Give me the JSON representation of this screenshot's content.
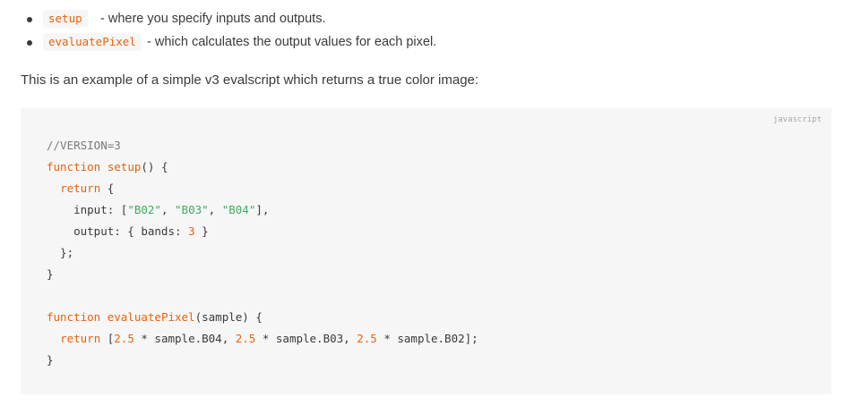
{
  "bullets": [
    {
      "code": "setup",
      "text": "- where you specify inputs and outputs."
    },
    {
      "code": "evaluatePixel",
      "text": "- which calculates the output values for each pixel."
    }
  ],
  "intro": "This is an example of a simple v3 evalscript which returns a true color image:",
  "code_block": {
    "language": "javascript",
    "lines": [
      "//VERSION=3",
      "function setup() {",
      "  return {",
      "    input: [\"B02\", \"B03\", \"B04\"],",
      "    output: { bands: 3 }",
      "  };",
      "}",
      "",
      "function evaluatePixel(sample) {",
      "  return [2.5 * sample.B04, 2.5 * sample.B03, 2.5 * sample.B02];",
      "}"
    ]
  },
  "colors": {
    "keyword": "#e8620c",
    "string": "#3fab5e",
    "comment": "#7a7a7a",
    "code_background": "#f6f6f6"
  }
}
